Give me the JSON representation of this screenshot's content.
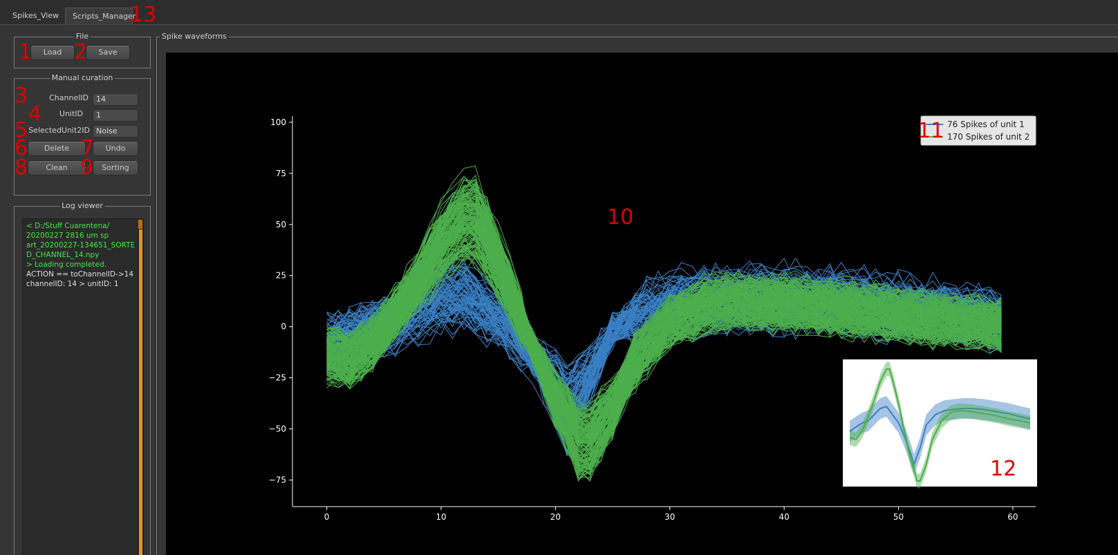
{
  "tabs": [
    {
      "label": "Spikes_View"
    },
    {
      "label": "Scripts_Manager"
    }
  ],
  "file_group": {
    "title": "File",
    "load_label": "Load",
    "save_label": "Save"
  },
  "manual_group": {
    "title": "Manual curation",
    "channel_label": "ChannelID",
    "channel_value": "14",
    "unit_label": "UnitID",
    "unit_value": "1",
    "selected_label": "SelectedUnit2ID",
    "selected_value": "Noise",
    "delete_label": "Delete",
    "undo_label": "Undo",
    "clean_label": "Clean",
    "sorting_label": "Sorting"
  },
  "log_group": {
    "title": "Log viewer",
    "lines": [
      {
        "text": "< D:/Stuff Cuarentena/",
        "color": "green"
      },
      {
        "text": "20200227 2816 um sp",
        "color": "green"
      },
      {
        "text": "art_20200227-134651_SORTE",
        "color": "green"
      },
      {
        "text": "D_CHANNEL_14.npy",
        "color": "green"
      },
      {
        "text": "> Loading completed.",
        "color": "green"
      },
      {
        "text": "ACTION == toChannelID->14",
        "color": "white"
      },
      {
        "text": "channelID: 14 > unitID: 1",
        "color": "white"
      }
    ]
  },
  "spike_group": {
    "title": "Spike waveforms"
  },
  "annotations": [
    "1",
    "2",
    "3",
    "4",
    "5",
    "6",
    "7",
    "8",
    "9",
    "10",
    "11",
    "12",
    "13"
  ],
  "colors": {
    "unit1": "#3a7fc4",
    "unit2": "#4cae4c",
    "annotation": "#e00000",
    "log_green": "#43e843",
    "scroll_orange": "#e8941a"
  },
  "chart_data": {
    "type": "line",
    "title": "",
    "xlabel": "",
    "ylabel": "",
    "xlim": [
      -3,
      62
    ],
    "ylim": [
      -88,
      103
    ],
    "x_ticks": [
      0,
      10,
      20,
      30,
      40,
      50,
      60
    ],
    "y_ticks": [
      -75,
      -50,
      -25,
      0,
      25,
      50,
      75,
      100
    ],
    "legend_position": "top-right",
    "legend": [
      {
        "name": "76 Spikes of unit 1",
        "color": "#3a7fc4"
      },
      {
        "name": "170 Spikes of unit 2",
        "color": "#4cae4c"
      }
    ],
    "series": [
      {
        "name": "76 Spikes of unit 1",
        "count": 76,
        "color": "#3a7fc4",
        "mean_x": [
          0,
          2,
          4,
          6,
          8,
          10,
          12,
          13,
          14,
          16,
          18,
          20,
          21,
          23,
          25,
          28,
          31,
          34,
          37,
          40,
          44,
          48,
          52,
          56,
          59
        ],
        "mean_y": [
          -8,
          -4,
          0,
          2,
          8,
          14,
          16,
          12,
          8,
          0,
          -14,
          -30,
          -40,
          -24,
          -2,
          8,
          12,
          13,
          14,
          14,
          13,
          11,
          9,
          6,
          4
        ]
      },
      {
        "name": "170 Spikes of unit 2",
        "count": 170,
        "color": "#4cae4c",
        "mean_x": [
          0,
          2,
          4,
          6,
          8,
          10,
          12,
          13,
          14,
          16,
          18,
          20,
          21,
          22,
          23,
          25,
          27,
          30,
          33,
          36,
          40,
          44,
          48,
          52,
          56,
          59
        ],
        "mean_y": [
          -14,
          -16,
          -8,
          6,
          22,
          40,
          52,
          52,
          42,
          18,
          -10,
          -36,
          -44,
          -56,
          -56,
          -40,
          -16,
          2,
          10,
          12,
          11,
          9,
          7,
          4,
          2,
          0
        ]
      }
    ],
    "inset": {
      "type": "line",
      "description_series": [
        {
          "name": "unit 1 mean",
          "color": "#3a7fc4",
          "x": [
            0,
            2,
            4,
            6,
            8,
            10,
            12,
            13,
            14,
            16,
            18,
            20,
            21,
            23,
            25,
            28,
            31,
            34,
            37,
            40,
            44,
            48,
            52,
            56,
            59
          ],
          "y": [
            -8,
            -4,
            0,
            2,
            8,
            14,
            16,
            12,
            8,
            0,
            -14,
            -30,
            -40,
            -24,
            -2,
            8,
            12,
            13,
            14,
            14,
            13,
            11,
            9,
            6,
            4
          ]
        },
        {
          "name": "unit 2 mean",
          "color": "#4cae4c",
          "x": [
            0,
            2,
            4,
            6,
            8,
            10,
            12,
            13,
            14,
            16,
            18,
            20,
            21,
            22,
            23,
            25,
            27,
            30,
            33,
            36,
            40,
            44,
            48,
            52,
            56,
            59
          ],
          "y": [
            -14,
            -16,
            -8,
            6,
            22,
            40,
            52,
            52,
            42,
            18,
            -10,
            -36,
            -44,
            -56,
            -56,
            -40,
            -16,
            2,
            10,
            12,
            11,
            9,
            7,
            4,
            2,
            0
          ]
        }
      ]
    }
  }
}
